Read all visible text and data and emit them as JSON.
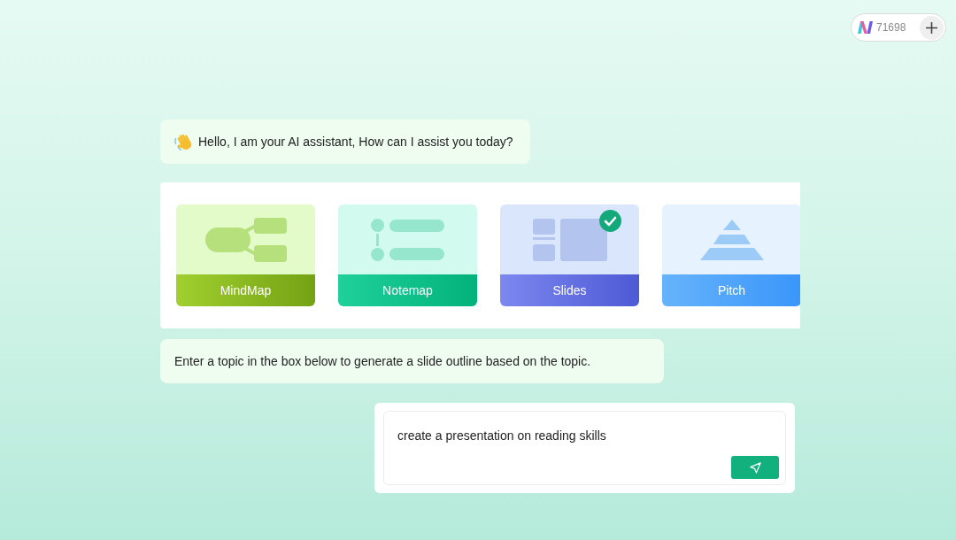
{
  "credits": {
    "count": "71698"
  },
  "greeting": {
    "text": "Hello, I am your AI assistant, How can I assist you today?"
  },
  "modes": [
    {
      "label": "MindMap",
      "kind": "mindmap",
      "selected": false
    },
    {
      "label": "Notemap",
      "kind": "notemap",
      "selected": false
    },
    {
      "label": "Slides",
      "kind": "slides",
      "selected": true
    },
    {
      "label": "Pitch",
      "kind": "pitch",
      "selected": false
    }
  ],
  "instruction": {
    "text": "Enter a topic in the box below to generate a slide outline based on the topic."
  },
  "prompt": {
    "value": "create a presentation on reading skills"
  }
}
